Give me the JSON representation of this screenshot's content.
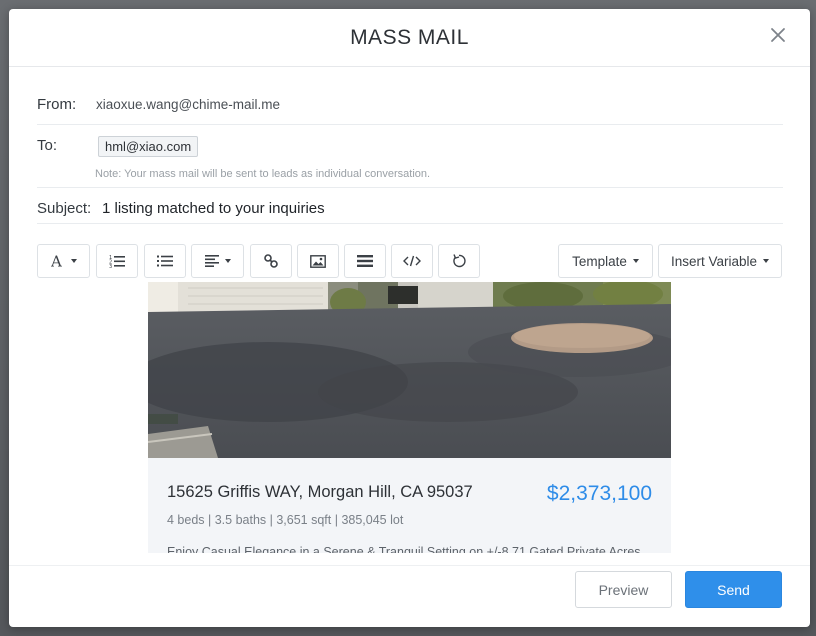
{
  "modal": {
    "title": "MASS MAIL"
  },
  "from": {
    "label": "From:",
    "value": "xiaoxue.wang@chime-mail.me"
  },
  "to": {
    "label": "To:",
    "recipient": "hml@xiao.com",
    "note": "Note: Your mass mail will be sent to leads as individual conversation."
  },
  "subject": {
    "label": "Subject:",
    "value": "1 listing matched to your inquiries"
  },
  "toolbar": {
    "font_icon": "font-format-icon",
    "ordered_list_icon": "ordered-list-icon",
    "unordered_list_icon": "unordered-list-icon",
    "align_icon": "align-icon",
    "link_icon": "link-icon",
    "image_icon": "image-icon",
    "hr_icon": "horizontal-rule-icon",
    "code_icon": "code-view-icon",
    "undo_icon": "undo-icon",
    "template_label": "Template",
    "insert_variable_label": "Insert Variable"
  },
  "listing": {
    "address": "15625 Griffis WAY, Morgan Hill, CA 95037",
    "price": "$2,373,100",
    "facts": "4 beds | 3.5 baths | 3,651 sqft | 385,045 lot",
    "description": "Enjoy Casual Elegance in a Serene & Tranquil Setting on +/-8.71 Gated Private Acres"
  },
  "footer": {
    "preview_label": "Preview",
    "send_label": "Send"
  },
  "colors": {
    "accent": "#2f8fea",
    "price": "#2e8ce8"
  }
}
